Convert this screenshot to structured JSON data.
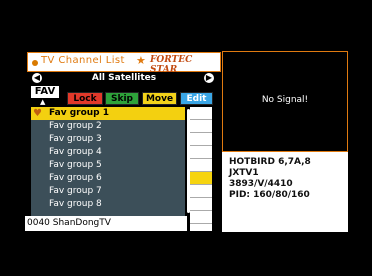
{
  "header": {
    "title": "TV  Channel  List",
    "brand": "FORTEC STAR"
  },
  "satellite": {
    "name": "All Satellites"
  },
  "tabs": {
    "fav": "FAV"
  },
  "buttons": {
    "lock": "Lock",
    "skip": "Skip",
    "move": "Move",
    "edit": "Edit"
  },
  "list": {
    "items": [
      "Fav  group  1",
      "Fav  group  2",
      "Fav  group  3",
      "Fav  group  4",
      "Fav  group  5",
      "Fav  group  6",
      "Fav  group  7",
      "Fav  group  8"
    ],
    "selected_index": 0
  },
  "status": {
    "channel": "0040 ShanDongTV"
  },
  "preview": {
    "message": "No Signal!"
  },
  "info": {
    "satellite": "HOTBIRD 6,7A,8",
    "channel": "JXTV1",
    "transponder": "3893/V/4410",
    "pid": "PID: 160/80/160"
  },
  "colors": {
    "accent": "#e07a10",
    "selection": "#f3d010",
    "list_bg": "#3c4f59"
  }
}
